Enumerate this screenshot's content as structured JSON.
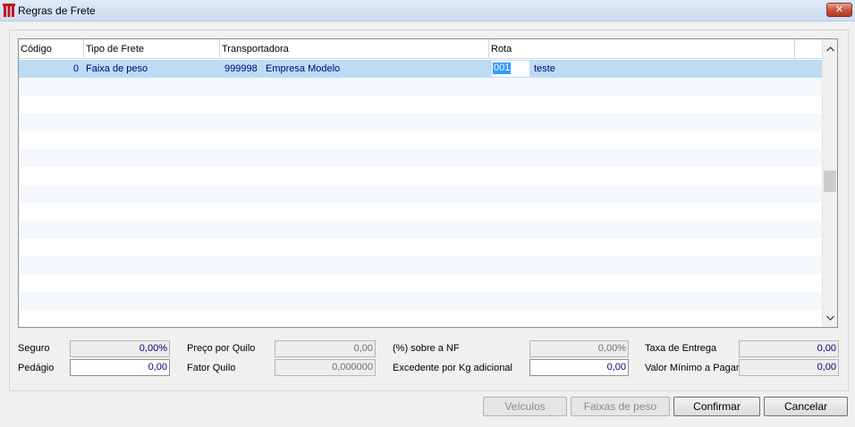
{
  "window": {
    "title": "Regras de Frete",
    "close_label": "✕"
  },
  "grid": {
    "columns": [
      "Código",
      "Tipo de Frete",
      "Transportadora",
      "Rota"
    ],
    "rows": [
      {
        "codigo": "0",
        "tipo_frete": "Faixa de peso",
        "transportadora_codigo": "999998",
        "transportadora_nome": "Empresa Modelo",
        "rota_codigo": "001",
        "rota_nome": "teste"
      }
    ]
  },
  "fields": {
    "seguro": {
      "label": "Seguro",
      "value": "0,00%"
    },
    "pedagio": {
      "label": "Pedágio",
      "value": "0,00"
    },
    "preco_por_quilo": {
      "label": "Preço por Quilo",
      "value": "0,00"
    },
    "fator_quilo": {
      "label": "Fator Quilo",
      "value": "0,000000"
    },
    "sobre_nf": {
      "label": "(%) sobre a NF",
      "value": "0,00%"
    },
    "excedente_kg": {
      "label": "Excedente por Kg adicional",
      "value": "0,00"
    },
    "taxa_entrega": {
      "label": "Taxa de Entrega",
      "value": "0,00"
    },
    "valor_minimo": {
      "label": "Valor Mínimo a Pagar",
      "value": "0,00"
    }
  },
  "buttons": {
    "veiculos": "Veículos",
    "faixas_de_peso": "Faixas de peso",
    "confirmar": "Confirmar",
    "cancelar": "Cancelar"
  },
  "colors": {
    "selected_row": "#bcdcf4",
    "value_text": "#000080",
    "close_button": "#c7503a"
  },
  "icons": {
    "app": "app-logo-icon",
    "close": "close-icon",
    "scroll_up": "chevron-up-icon",
    "scroll_down": "chevron-down-icon"
  }
}
